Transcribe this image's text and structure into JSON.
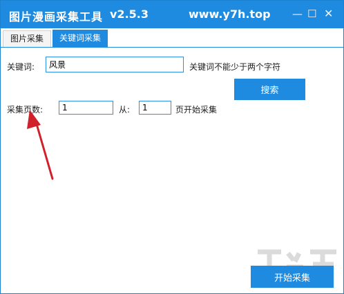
{
  "window": {
    "title": "图片漫画采集工具",
    "version": "v2.5.3",
    "site": "www.y7h.top",
    "min_glyph": "—",
    "max_glyph": "☐",
    "close_glyph": "✕"
  },
  "tabs": [
    {
      "label": "图片采集"
    },
    {
      "label": "关键词采集"
    }
  ],
  "keyword": {
    "label": "关键词:",
    "value": "风景",
    "hint": "关键词不能少于两个字符"
  },
  "search_button": "搜索",
  "pages": {
    "label": "采集页数:",
    "value": "1",
    "from_label": "从:",
    "from_value": "1",
    "suffix": "页开始采集"
  },
  "start_button": "开始采集",
  "colors": {
    "accent": "#1e8ae0",
    "arrow": "#d0202a"
  }
}
